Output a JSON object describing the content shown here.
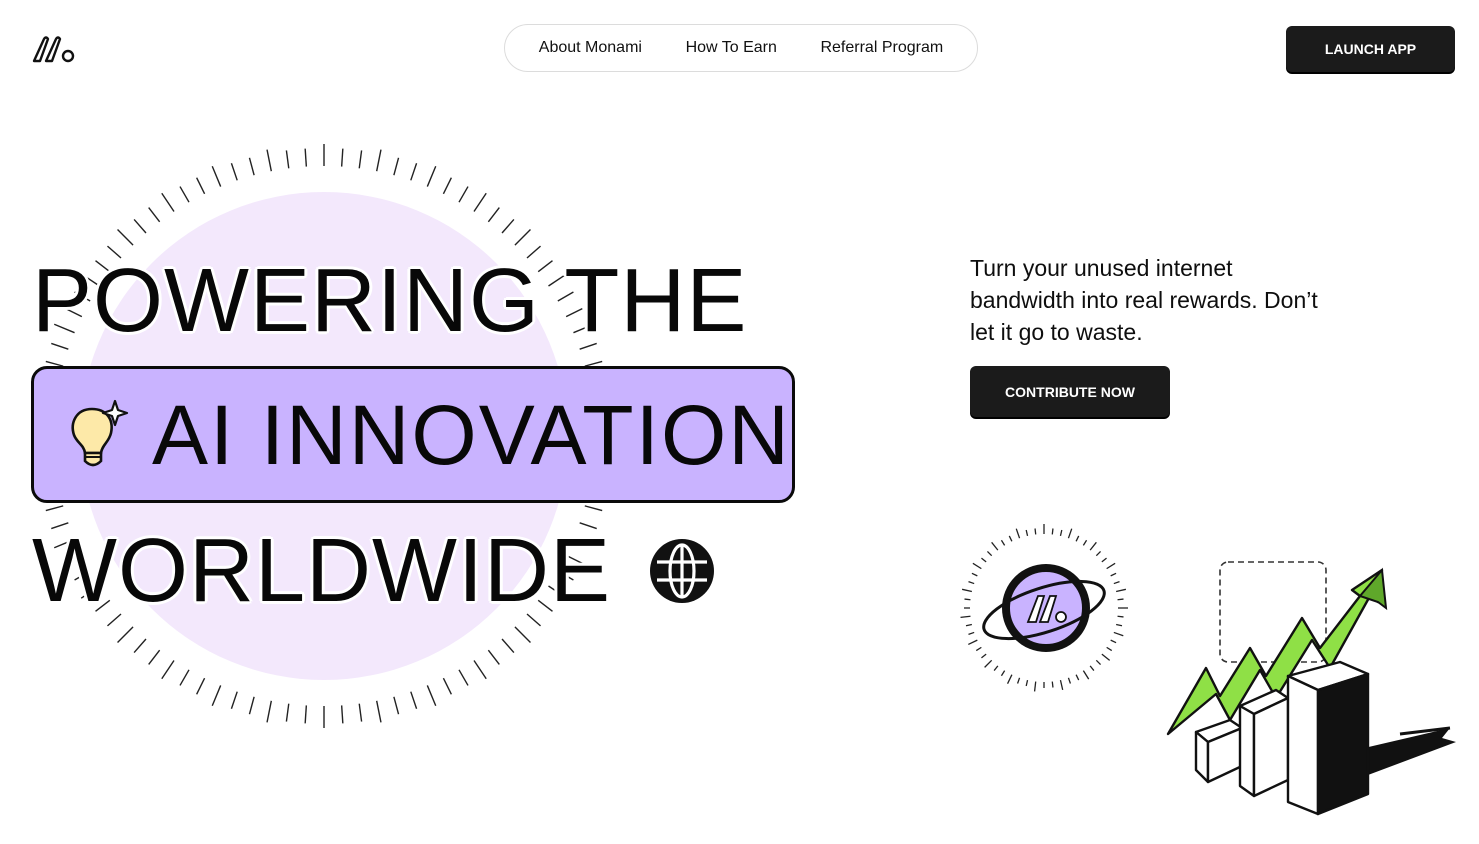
{
  "header": {
    "logo_icon": "monami-logo-icon",
    "nav": [
      {
        "label": "About Monami"
      },
      {
        "label": "How To Earn"
      },
      {
        "label": "Referral Program"
      }
    ],
    "launch_label": "LAUNCH APP"
  },
  "hero": {
    "line1": "POWERING THE",
    "line2": "AI INNOVATION",
    "line3": "WORLDWIDE",
    "line2_icon": "lightbulb-sparkle-icon",
    "line3_icon": "globe-icon",
    "tagline": "Turn your unused internet bandwidth into real rewards. Don’t let it go to waste.",
    "cta_label": "CONTRIBUTE NOW",
    "planet_icon": "monami-planet-icon",
    "growth_icon": "growth-chart-illustration"
  },
  "colors": {
    "accent": "#c9b3ff",
    "circle": "#f3e8fc",
    "button": "#1b1b1b",
    "arrow": "#8fe046"
  }
}
